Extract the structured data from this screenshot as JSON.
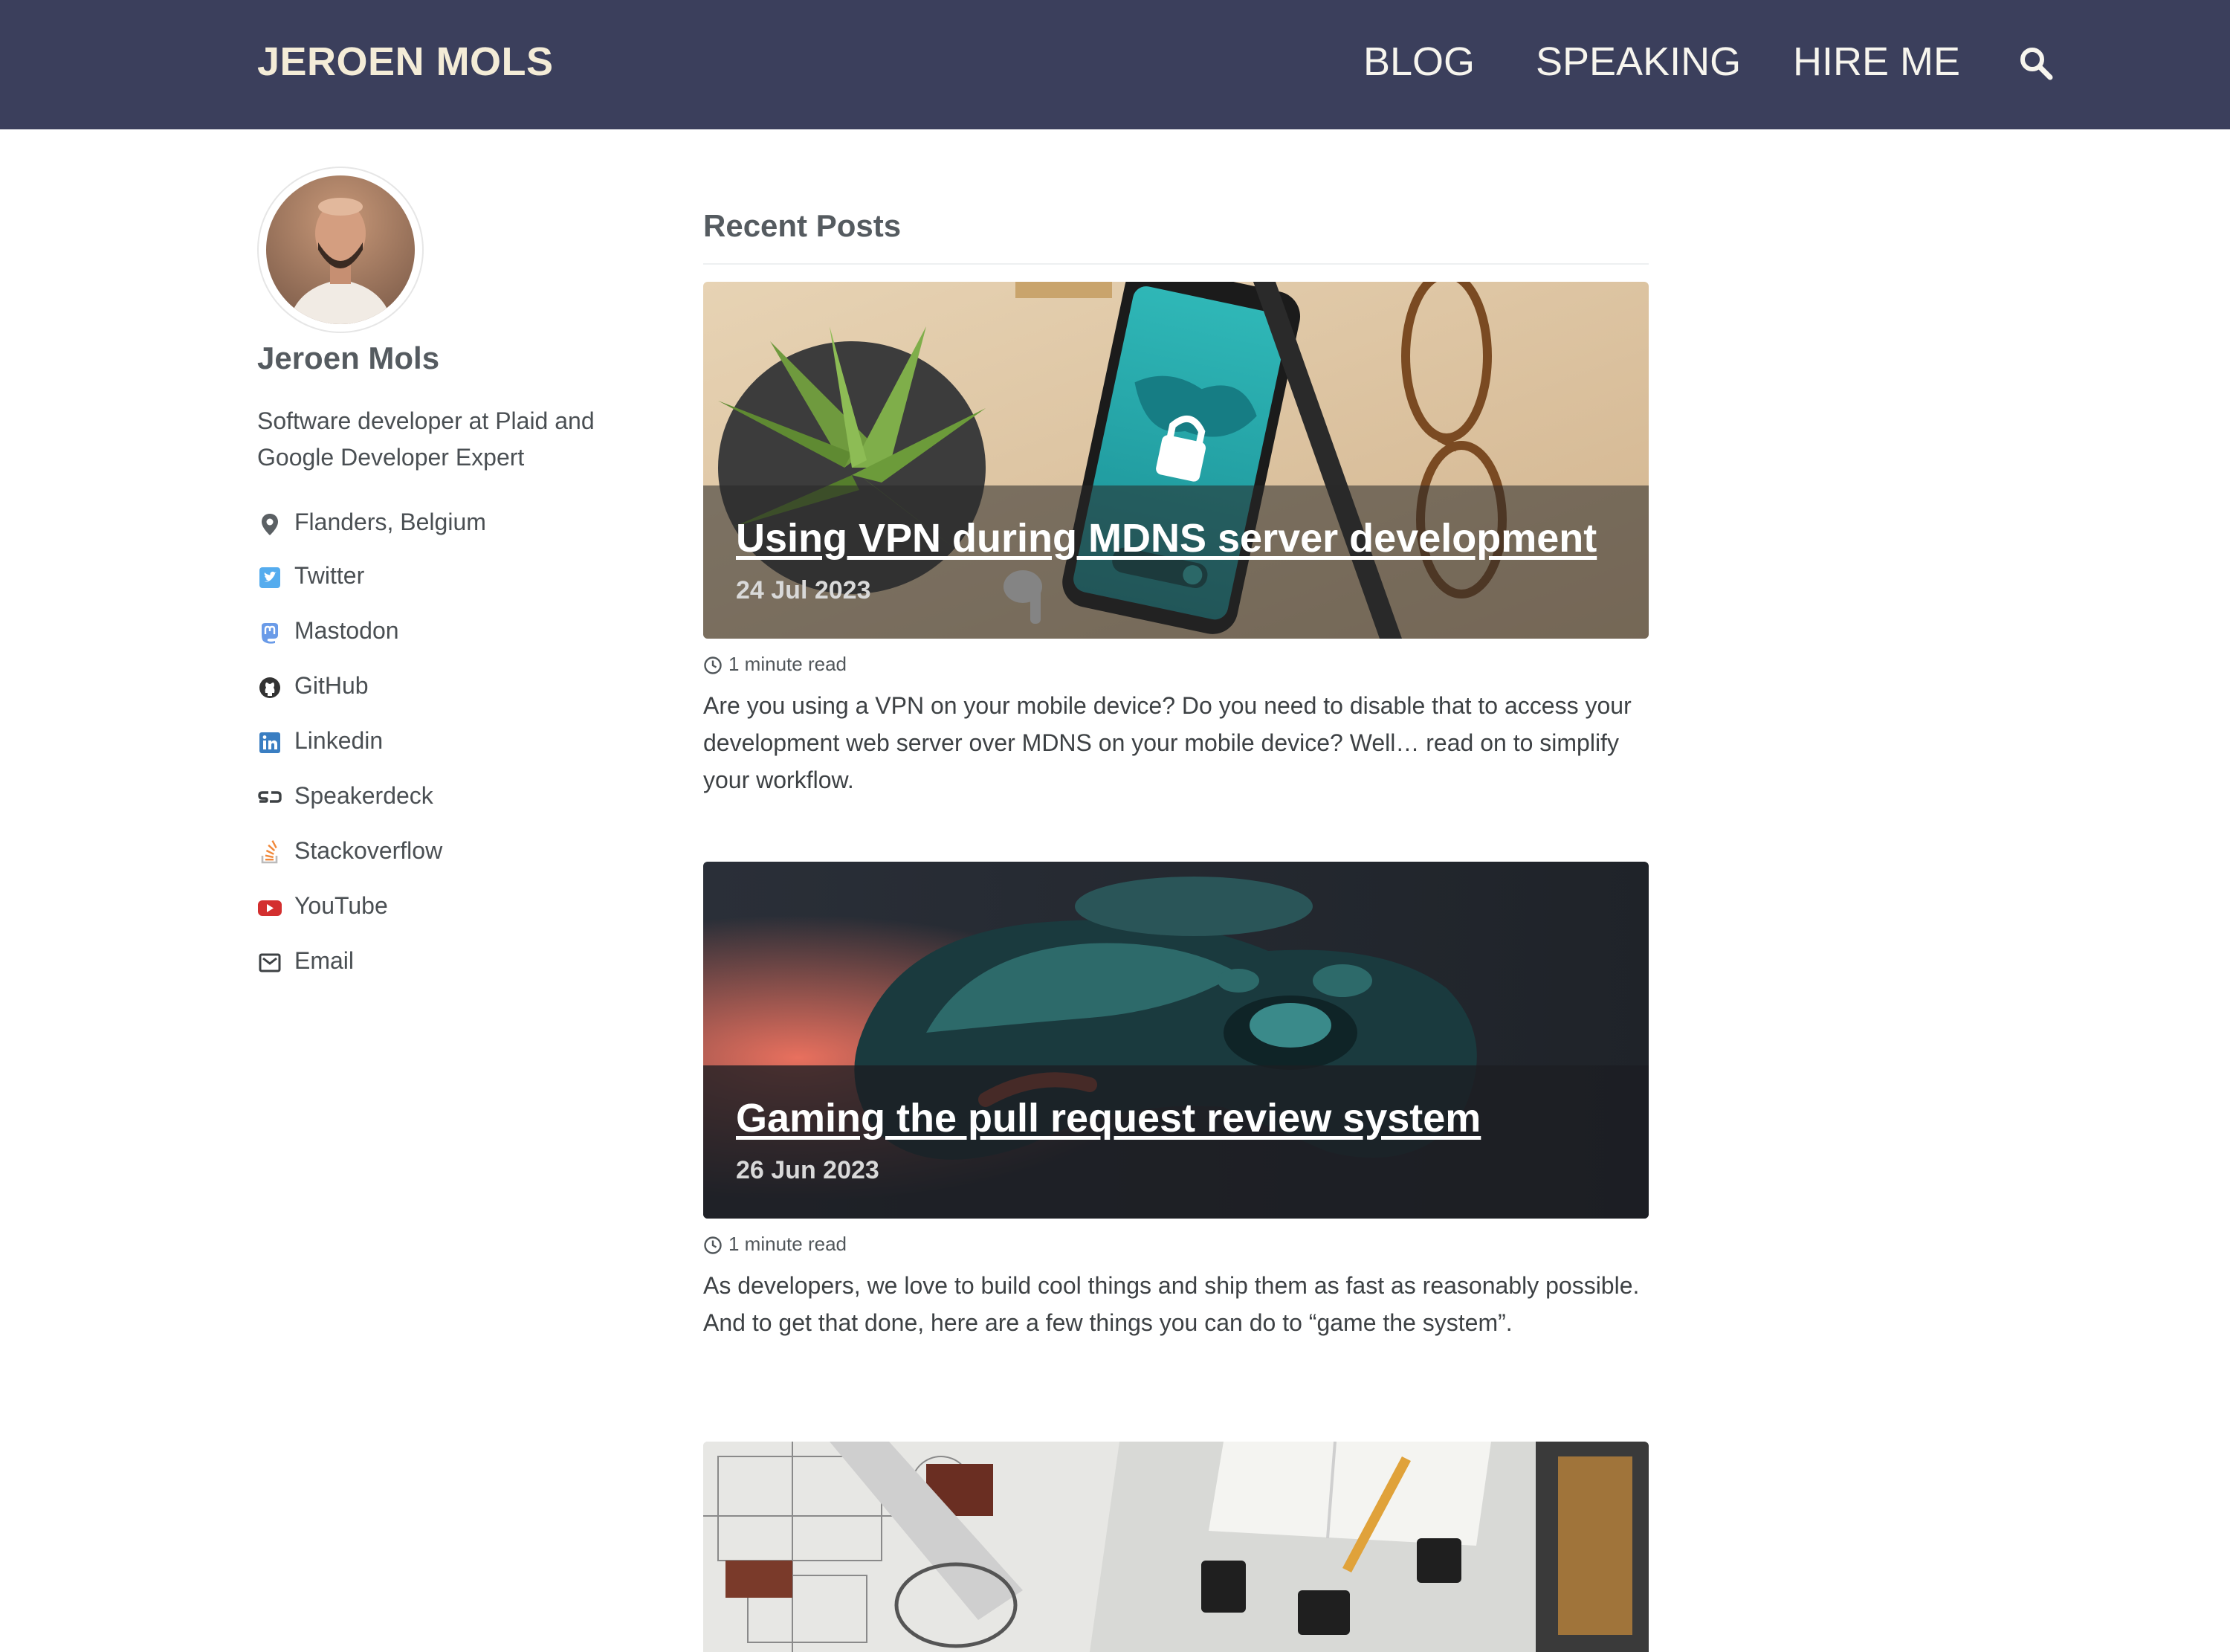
{
  "header": {
    "site_title": "JEROEN MOLS",
    "nav": [
      {
        "label": "BLOG"
      },
      {
        "label": "SPEAKING"
      },
      {
        "label": "HIRE ME"
      }
    ],
    "search_icon": "search-icon",
    "background": "#3b3f5c"
  },
  "sidebar": {
    "name": "Jeroen Mols",
    "bio": "Software developer at Plaid and Google Developer Expert",
    "links": [
      {
        "label": "Flanders, Belgium",
        "icon": "map-marker-icon",
        "color": "#5b6064"
      },
      {
        "label": "Twitter",
        "icon": "twitter-icon",
        "color": "#55acee"
      },
      {
        "label": "Mastodon",
        "icon": "mastodon-icon",
        "color": "#6a9be8"
      },
      {
        "label": "GitHub",
        "icon": "github-icon",
        "color": "#333333"
      },
      {
        "label": "Linkedin",
        "icon": "linkedin-icon",
        "color": "#3a7ec2"
      },
      {
        "label": "Speakerdeck",
        "icon": "speakerdeck-icon",
        "color": "#3d4144"
      },
      {
        "label": "Stackoverflow",
        "icon": "stackoverflow-icon",
        "color": "#f1883a"
      },
      {
        "label": "YouTube",
        "icon": "youtube-icon",
        "color": "#d32f2f"
      },
      {
        "label": "Email",
        "icon": "envelope-icon",
        "color": "#3d4144"
      }
    ]
  },
  "main": {
    "title": "Recent Posts",
    "posts": [
      {
        "title": "Using VPN during MDNS server development",
        "date": "24 Jul 2023",
        "read_time": "1 minute read",
        "excerpt": "Are you using a VPN on your mobile device? Do you need to disable that to access your development web server over MDNS on your mobile device? Well… read on to simplify your workflow."
      },
      {
        "title": "Gaming the pull request review system",
        "date": "26 Jun 2023",
        "read_time": "1 minute read",
        "excerpt": "As developers, we love to build cool things and ship them as fast as reasonably possible. And to get that done, here are a few things you can do to “game the system”."
      },
      {
        "title": "",
        "date": "",
        "read_time": "",
        "excerpt": ""
      }
    ]
  }
}
